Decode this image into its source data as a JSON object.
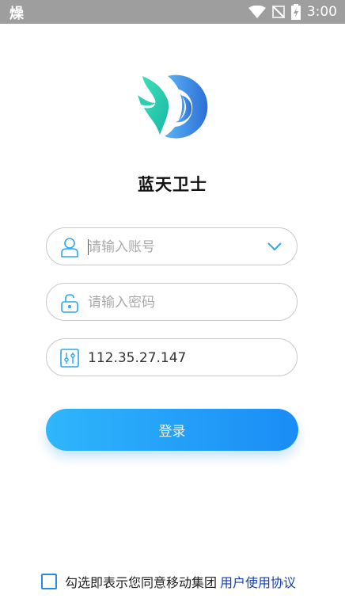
{
  "status_bar": {
    "left_glyph": "燥",
    "time": "3:00",
    "icons": [
      "wifi-icon",
      "signal-off-icon",
      "battery-charging-icon"
    ]
  },
  "app": {
    "title": "蓝天卫士",
    "logo_icon": "lantian-logo-icon"
  },
  "form": {
    "account": {
      "placeholder": "请输入账号",
      "value": "",
      "icon": "user-icon",
      "dropdown_icon": "chevron-down-icon"
    },
    "password": {
      "placeholder": "请输入密码",
      "value": "",
      "icon": "lock-icon"
    },
    "server": {
      "placeholder": "",
      "value": "112.35.27.147",
      "icon": "settings-sliders-icon"
    },
    "login_label": "登录"
  },
  "agreement": {
    "checked": false,
    "text": "勾选即表示您同意移动集团",
    "link_text": "用户使用协议"
  },
  "colors": {
    "accent": "#1a8cf6",
    "link": "#1440b5",
    "icon": "#2aa7f0"
  }
}
